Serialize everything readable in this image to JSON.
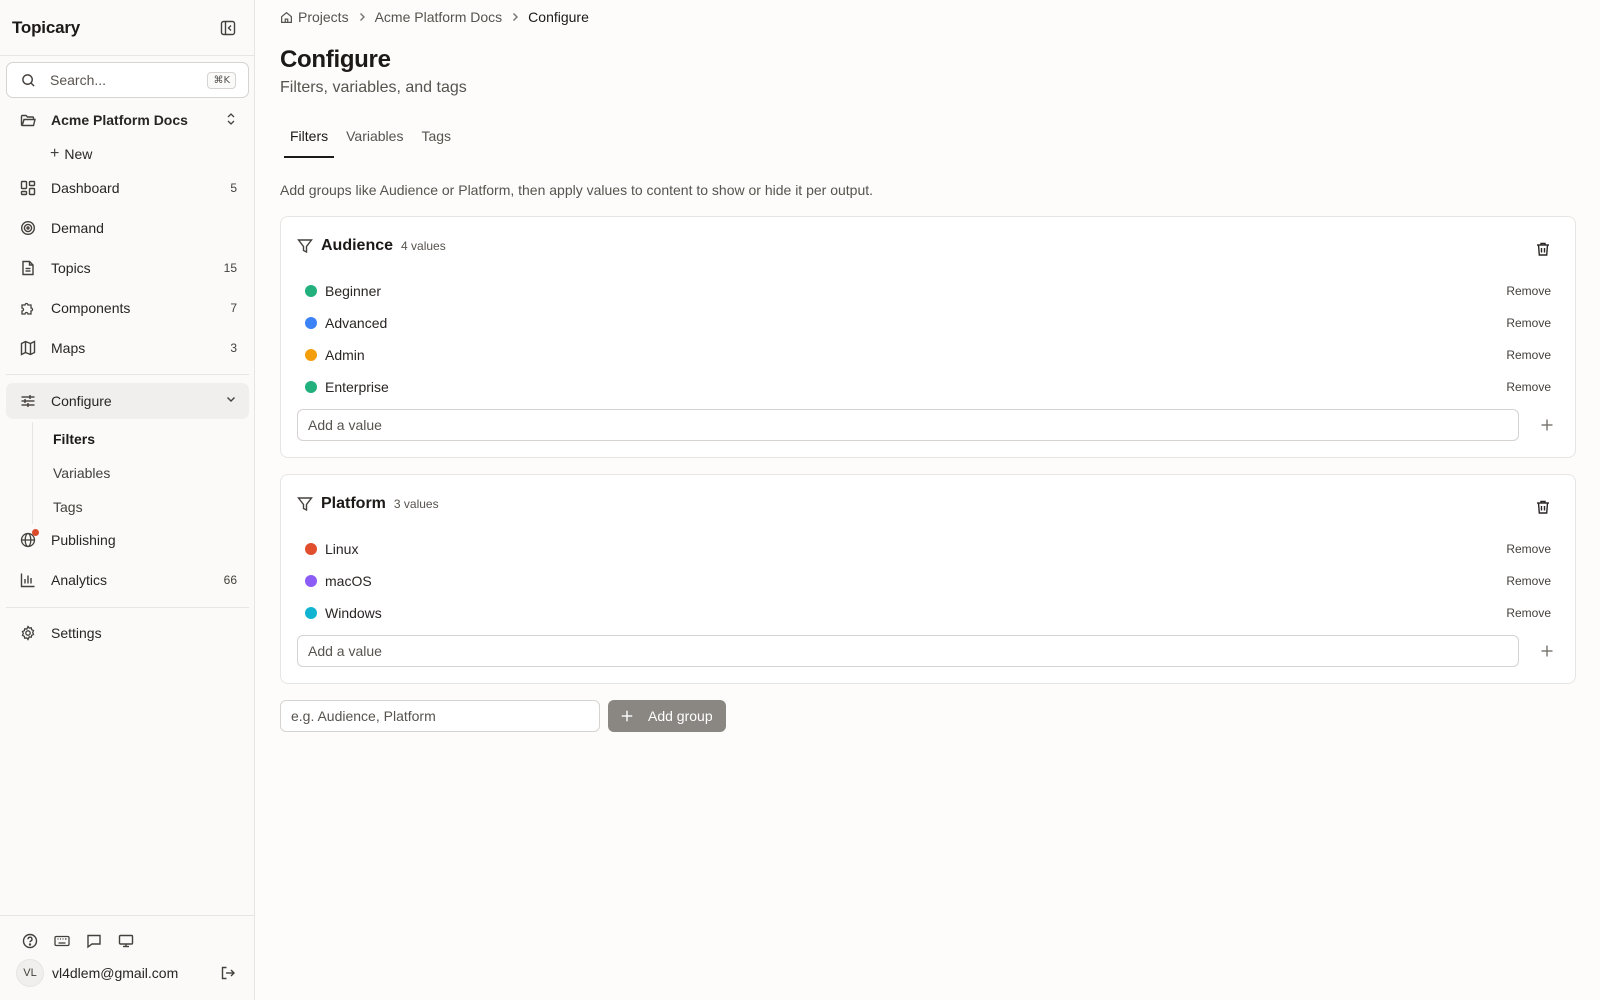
{
  "app": {
    "name": "Topicary"
  },
  "sidebar": {
    "search": {
      "placeholder": "Search...",
      "shortcut": "⌘K"
    },
    "project": {
      "name": "Acme Platform Docs"
    },
    "new_label": "New",
    "items": [
      {
        "label": "Dashboard",
        "count": "5",
        "icon": "dashboard-icon"
      },
      {
        "label": "Demand",
        "count": "",
        "icon": "target-icon"
      },
      {
        "label": "Topics",
        "count": "15",
        "icon": "document-icon"
      },
      {
        "label": "Components",
        "count": "7",
        "icon": "puzzle-icon"
      },
      {
        "label": "Maps",
        "count": "3",
        "icon": "map-icon"
      }
    ],
    "configure": {
      "label": "Configure",
      "sub": [
        {
          "label": "Filters"
        },
        {
          "label": "Variables"
        },
        {
          "label": "Tags"
        }
      ]
    },
    "items2": [
      {
        "label": "Publishing",
        "count": "",
        "icon": "globe-icon"
      },
      {
        "label": "Analytics",
        "count": "66",
        "icon": "bar-chart-icon"
      }
    ],
    "settings": {
      "label": "Settings"
    },
    "user": {
      "initials": "VL",
      "email": "vl4dlem@gmail.com"
    }
  },
  "breadcrumb": {
    "items": [
      {
        "label": "Projects"
      },
      {
        "label": "Acme Platform Docs"
      }
    ],
    "current": "Configure"
  },
  "page": {
    "title": "Configure",
    "subtitle": "Filters, variables, and tags",
    "tabs": [
      {
        "label": "Filters"
      },
      {
        "label": "Variables"
      },
      {
        "label": "Tags"
      }
    ],
    "description": "Add groups like Audience or Platform, then apply values to content to show or hide it per output."
  },
  "groups": [
    {
      "name": "Audience",
      "count": "4 values",
      "add_placeholder": "Add a value",
      "values": [
        {
          "label": "Beginner",
          "color": "#22b07d"
        },
        {
          "label": "Advanced",
          "color": "#3b82f6"
        },
        {
          "label": "Admin",
          "color": "#f59e0b"
        },
        {
          "label": "Enterprise",
          "color": "#22b07d"
        }
      ]
    },
    {
      "name": "Platform",
      "count": "3 values",
      "add_placeholder": "Add a value",
      "values": [
        {
          "label": "Linux",
          "color": "#e14e2e"
        },
        {
          "label": "macOS",
          "color": "#8b5cf6"
        },
        {
          "label": "Windows",
          "color": "#10b4d0"
        }
      ]
    }
  ],
  "remove_label": "Remove",
  "new_group": {
    "placeholder": "e.g. Audience, Platform",
    "button_label": "Add group"
  }
}
